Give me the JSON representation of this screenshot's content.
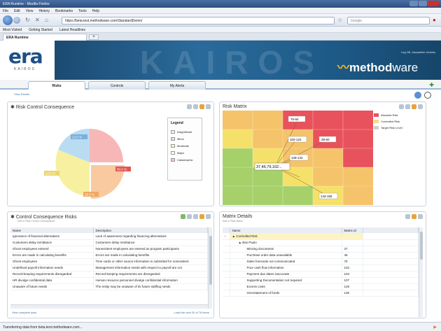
{
  "window": {
    "title": "ERA Runtime - Mozilla Firefox"
  },
  "menu": [
    "File",
    "Edit",
    "View",
    "History",
    "Bookmarks",
    "Tools",
    "Help"
  ],
  "navbar": {
    "url": "https://beta.test.methodware.com/StandardDemo/",
    "search_placeholder": "Google"
  },
  "bookmarks": [
    "Most Visited",
    "Getting Started",
    "Latest Headlines"
  ],
  "browser_tab": {
    "label": "ERA Runtime"
  },
  "banner": {
    "logo_main": "era",
    "logo_sub": "KAIROS",
    "watermark": "KAIROS",
    "brand_method": "method",
    "brand_ware": "ware",
    "user_info": "Log Off, Jacqueline Jenkins"
  },
  "app_tabs": [
    "Risks",
    "Controls",
    "My Alerts"
  ],
  "toolbar": {
    "view_panels": "View Panels"
  },
  "risk_control_consequence": {
    "title": "Risk Control Consequence",
    "legend_title": "Legend",
    "legend": [
      {
        "label": "Insignificant",
        "color": "#f2f2f2"
      },
      {
        "label": "Minor",
        "color": "#cfe6f7"
      },
      {
        "label": "Moderate",
        "color": "#fbf6b8"
      },
      {
        "label": "Major",
        "color": "#ffffff"
      },
      {
        "label": "Catastrophic",
        "color": "#f7c9c9"
      }
    ],
    "pie_labels": [
      "12.5 %",
      "50.0 %",
      "12.5 %",
      "25.0 %"
    ]
  },
  "risk_matrix": {
    "title": "Risk Matrix",
    "legend": [
      {
        "label": "Absolute Risk",
        "color": "#e8525c"
      },
      {
        "label": "Controlled Risk",
        "color": "#f6d98a"
      },
      {
        "label": "Target Risk Level",
        "color": "#d0d0d0"
      }
    ],
    "cell_labels": [
      "76-84",
      "102-124",
      "38-60",
      "128-144",
      "143-165"
    ],
    "callout": "37,46,79,102..."
  },
  "control_consequence_risks": {
    "title": "Control Consequence Risks",
    "subtitle": "Drill of 'Risk Control Consequence'",
    "columns": [
      "Name",
      "Description"
    ],
    "rows": [
      [
        "Ignorance of financial alternatives",
        "Lack of awareness regarding financing alternatives"
      ],
      [
        "Customers delay remittance",
        "Customers delay remittance"
      ],
      [
        "Ghost employees entered",
        "Nonexistent employees are entered as program participants"
      ],
      [
        "Errors are made in calculating benefits",
        "Errors are made in calculating benefits"
      ],
      [
        "Ghost employees",
        "Time cards or other source information is submitted for nonexistent"
      ],
      [
        "Undefined payroll information needs",
        "Management information needs with respect to payroll are not"
      ],
      [
        "Record-keeping requirements disregarded",
        "Record-keeping requirements are disregarded"
      ],
      [
        "HR divulge confidential data",
        "Human resource personnel divulge confidential information"
      ],
      [
        "Unaware of future needs",
        "The entity may be unaware of its future staffing needs"
      ]
    ],
    "footer_left": "View complete data",
    "footer_right": "Load the next 20 of 78 items"
  },
  "matrix_details": {
    "title": "Matrix Details",
    "subtitle": "Drill of 'Risk Matrix'",
    "columns": [
      "Name",
      "Matrix Id"
    ],
    "group": "Controlled Risk",
    "subgroup": "Bas Paulo",
    "rows": [
      [
        "Missing documents",
        "37"
      ],
      [
        "Purchase order data unavailable",
        "46"
      ],
      [
        "Sales forecasts not communicated",
        "79"
      ],
      [
        "Poor cash flow information",
        "102"
      ],
      [
        "Payment due dates inaccurate",
        "103"
      ],
      [
        "Supporting Documentation not required",
        "107"
      ],
      [
        "Excess costs",
        "128"
      ],
      [
        "Overstatement of funds",
        "135"
      ]
    ]
  },
  "status": {
    "text": "Transferring data from beta.test.methodware.com..."
  }
}
